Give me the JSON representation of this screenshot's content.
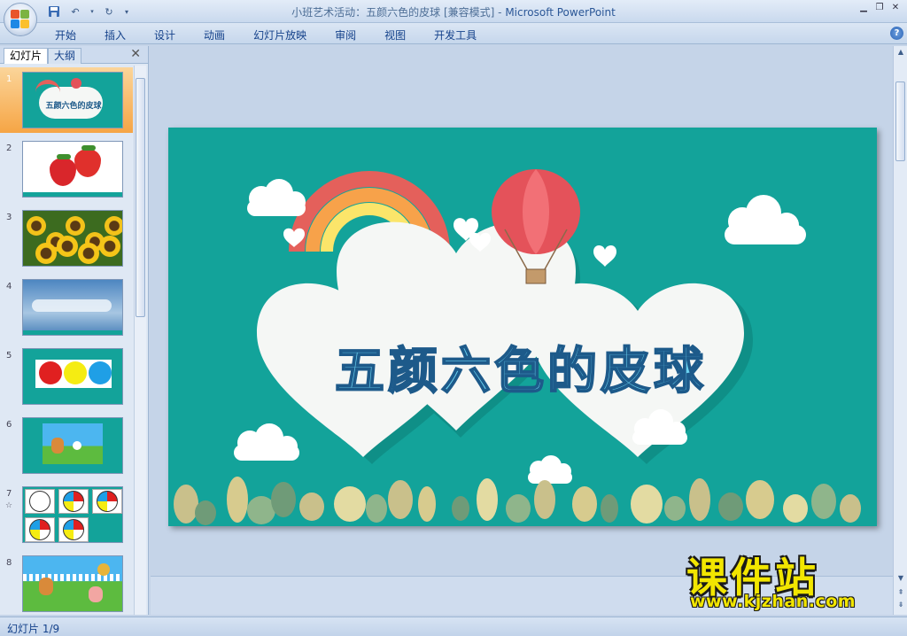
{
  "window": {
    "title": "小班艺术活动：五颜六色的皮球 [兼容模式]",
    "app_name": "Microsoft PowerPoint",
    "title_separator": " - "
  },
  "ribbon": {
    "tabs": [
      "开始",
      "插入",
      "设计",
      "动画",
      "幻灯片放映",
      "审阅",
      "视图",
      "开发工具"
    ]
  },
  "left_pane": {
    "tabs": {
      "slides": "幻灯片",
      "outline": "大纲"
    },
    "slides": [
      {
        "num": "1",
        "selected": true,
        "theme": "title"
      },
      {
        "num": "2",
        "theme": "strawberry"
      },
      {
        "num": "3",
        "theme": "sunflower"
      },
      {
        "num": "4",
        "theme": "sky"
      },
      {
        "num": "5",
        "theme": "circles"
      },
      {
        "num": "6",
        "theme": "squirrel"
      },
      {
        "num": "7",
        "theme": "balls",
        "has_animation": true
      },
      {
        "num": "8",
        "theme": "animals"
      }
    ],
    "slide1_caption": "五颜六色的皮球"
  },
  "slide": {
    "title": "五颜六色的皮球",
    "background": "#13a39a"
  },
  "status": {
    "slide_counter": "幻灯片 1/9"
  },
  "watermark": {
    "brand": "课件站",
    "url": "www.kjzhan.com"
  },
  "colors": {
    "accent": "#15428b",
    "selected_thumb": "#f6a545",
    "watermark": "#f2e600"
  }
}
